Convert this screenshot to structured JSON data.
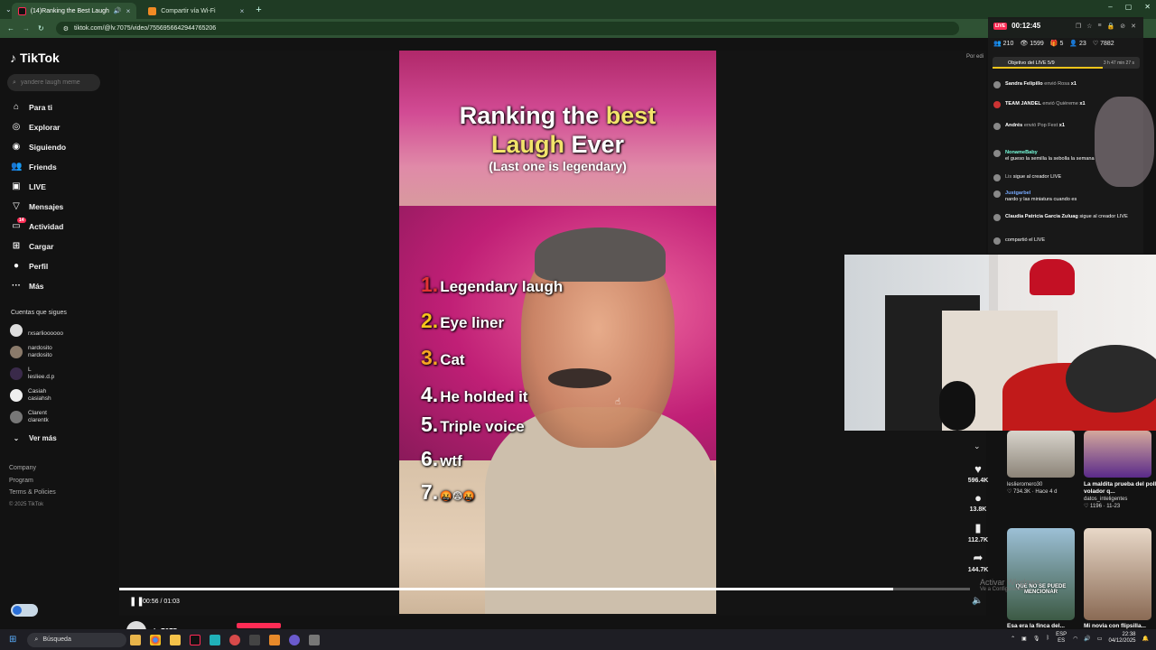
{
  "browser": {
    "tabs": [
      {
        "title": "(14)Ranking the Best Laugh"
      },
      {
        "title": "Compartir vía Wi-Fi"
      }
    ],
    "url": "tiktok.com/@lv.7075/video/7556956642944765206"
  },
  "sidebar": {
    "logo": "TikTok",
    "search_placeholder": "yandere laugh meme",
    "nav": [
      "Para ti",
      "Explorar",
      "Siguiendo",
      "Friends",
      "LIVE",
      "Mensajes",
      "Actividad",
      "Cargar",
      "Perfil",
      "Más"
    ],
    "activity_badge": "14",
    "following_title": "Cuentas que sigues",
    "accounts": [
      {
        "line1": "",
        "line2": "rxsarlioooooo"
      },
      {
        "line1": "nardosito",
        "line2": "nardosito"
      },
      {
        "line1": "L",
        "line2": "lesliee.d.p"
      },
      {
        "line1": "Casiah",
        "line2": "casiahsh"
      },
      {
        "line1": "Clarent",
        "line2": "clarentk"
      }
    ],
    "see_more": "Ver más",
    "footer": [
      "Company",
      "Program",
      "Terms & Policies"
    ],
    "copyright": "© 2025 TikTok"
  },
  "video": {
    "title_a": "Ranking the ",
    "title_hl1": "best",
    "title_b_hl": "Laugh",
    "title_c": " Ever",
    "subtitle": "(Last one is legendary)",
    "ranks": [
      {
        "num": "1.",
        "label": "Legendary laugh",
        "color": "#e33333"
      },
      {
        "num": "2.",
        "label": "Eye liner",
        "color": "#f5c41b"
      },
      {
        "num": "3.",
        "label": "Cat",
        "color": "#f5a623"
      },
      {
        "num": "4.",
        "label": "He holded it",
        "color": "#ffffff"
      },
      {
        "num": "5.",
        "label": "Triple voice",
        "color": "#ffffff"
      },
      {
        "num": "6.",
        "label": "wtf",
        "color": "#ffffff"
      },
      {
        "num": "7.",
        "label": "🤬😨🤬",
        "color": "#ffffff"
      }
    ],
    "time": "00:56 / 01:03",
    "progress": 0.91,
    "author": "lv.7075",
    "side_label": "Por edi"
  },
  "actions": {
    "likes": "596.4K",
    "comments": "13.8K",
    "saves": "112.7K",
    "shares": "144.7K"
  },
  "live": {
    "badge": "LIVE",
    "timer": "00:12:45",
    "stats": [
      "210",
      "1599",
      "5",
      "23",
      "7882"
    ],
    "goal": "Objetivo del LIVE 5/9",
    "goal_progress": 0.75,
    "goal_time": "3 h 47 min 27 s",
    "messages": [
      {
        "user": "Sandra Felipillo",
        "text": " envió Rosa ",
        "extra": "x1"
      },
      {
        "user": "TEAM JANDEL",
        "text": " envió Quiéreme ",
        "extra": "x1"
      },
      {
        "user": "Andrés",
        "text": " envió Pop Fest ",
        "extra": "x1"
      },
      {
        "user": "NonameBaby",
        "text": " el gueso la semilla la sebolla la semana",
        "extra": ""
      },
      {
        "user": "Lis",
        "text": " sigue al creador LIVE",
        "extra": ""
      },
      {
        "user": "Justgarbel",
        "text": " nardo y las miniatura cuando es",
        "extra": ""
      },
      {
        "user": "Claudia Patricia Garcia Zuluag",
        "text": " sigue al creador LIVE",
        "extra": ""
      },
      {
        "user": "",
        "text": " compartió el LIVE",
        "extra": ""
      }
    ]
  },
  "recommended": [
    {
      "title": "",
      "user": "leslieromero30",
      "meta": "♡ 734.3K · Hace 4 d"
    },
    {
      "title": "La maldita prueba del pollo volador q...",
      "user": "datos_inteligentes",
      "meta": "♡ 1196 · 11-23"
    },
    {
      "title": "Esa era la finca del...",
      "user": "",
      "meta": "",
      "overlay": "QUE NO SE PUEDE MENCIONAR"
    },
    {
      "title": "Mi novia con flipsilla...",
      "user": "",
      "meta": ""
    }
  ],
  "watermark": {
    "line1": "Activar Windows",
    "line2": "Ve a Configuración"
  },
  "taskbar": {
    "search": "Búsqueda",
    "lang": "ESP",
    "lang2": "ES",
    "time": "22:38",
    "date": "04/12/2025"
  }
}
